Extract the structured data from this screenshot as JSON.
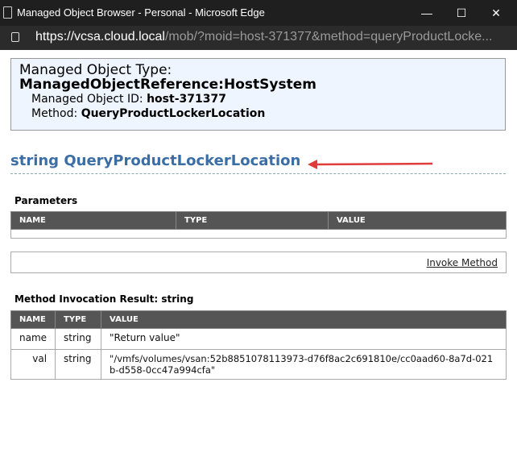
{
  "window": {
    "title": "Managed Object Browser - Personal - Microsoft Edge"
  },
  "address": {
    "url_host": "https://vcsa.cloud.local",
    "url_rest": "/mob/?moid=host-371377&method=queryProductLocke..."
  },
  "info": {
    "type_label": "Managed Object Type:",
    "type_value": "ManagedObjectReference:HostSystem",
    "id_label": "Managed Object ID:",
    "id_value": "host-371377",
    "method_label": "Method:",
    "method_value": "QueryProductLockerLocation"
  },
  "heading": "string QueryProductLockerLocation",
  "params": {
    "label": "Parameters",
    "headers": [
      "NAME",
      "TYPE",
      "VALUE"
    ]
  },
  "invoke_label": "Invoke Method",
  "result": {
    "label": "Method Invocation Result: string",
    "headers": [
      "NAME",
      "TYPE",
      "VALUE"
    ],
    "rows": [
      {
        "name": "name",
        "type": "string",
        "value": "\"Return value\""
      },
      {
        "name": "val",
        "type": "string",
        "value": "\"/vmfs/volumes/vsan:52b8851078113973-d76f8ac2c691810e/cc0aad60-8a7d-021b-d558-0cc47a994cfa\""
      }
    ]
  },
  "colors": {
    "heading": "#3a6ea5",
    "arrow": "#e03c3c",
    "header_bg": "#555555"
  }
}
